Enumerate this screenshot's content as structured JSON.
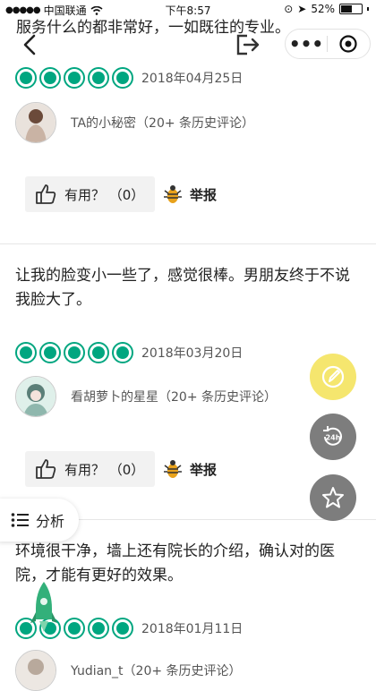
{
  "status_bar": {
    "carrier": "中国联通",
    "time": "下午8:57",
    "battery": "52%"
  },
  "top_partial_text": "服务什么的都非常好，一如既往的专业。",
  "reviews": [
    {
      "date": "2018年04月25日",
      "user": "TA的小秘密（20+ 条历史评论）",
      "helpful": "有用？ （0）",
      "report": "举报"
    },
    {
      "text": "让我的脸变小一些了，感觉很棒。男朋友终于不说我脸大了。",
      "date": "2018年03月20日",
      "user": "看胡萝卜的星星（20+ 条历史评论）",
      "helpful": "有用？ （0）",
      "report": "举报"
    },
    {
      "text": "环境很干净，墙上还有院长的介绍，确认对的医院，才能有更好的效果。",
      "date": "2018年01月11日",
      "user": "Yudian_t（20+ 条历史评论）"
    }
  ],
  "analysis_label": "分析",
  "colors": {
    "accent_green": "#00a680",
    "fab_yellow": "#f5e66e",
    "fab_gray": "#7d7d7d"
  },
  "icons": [
    "back-arrow-icon",
    "share-icon",
    "more-icon",
    "target-icon",
    "thumb-up-icon",
    "bug-report-icon",
    "edit-icon",
    "24h-icon",
    "star-icon",
    "list-icon",
    "rocket-icon"
  ]
}
